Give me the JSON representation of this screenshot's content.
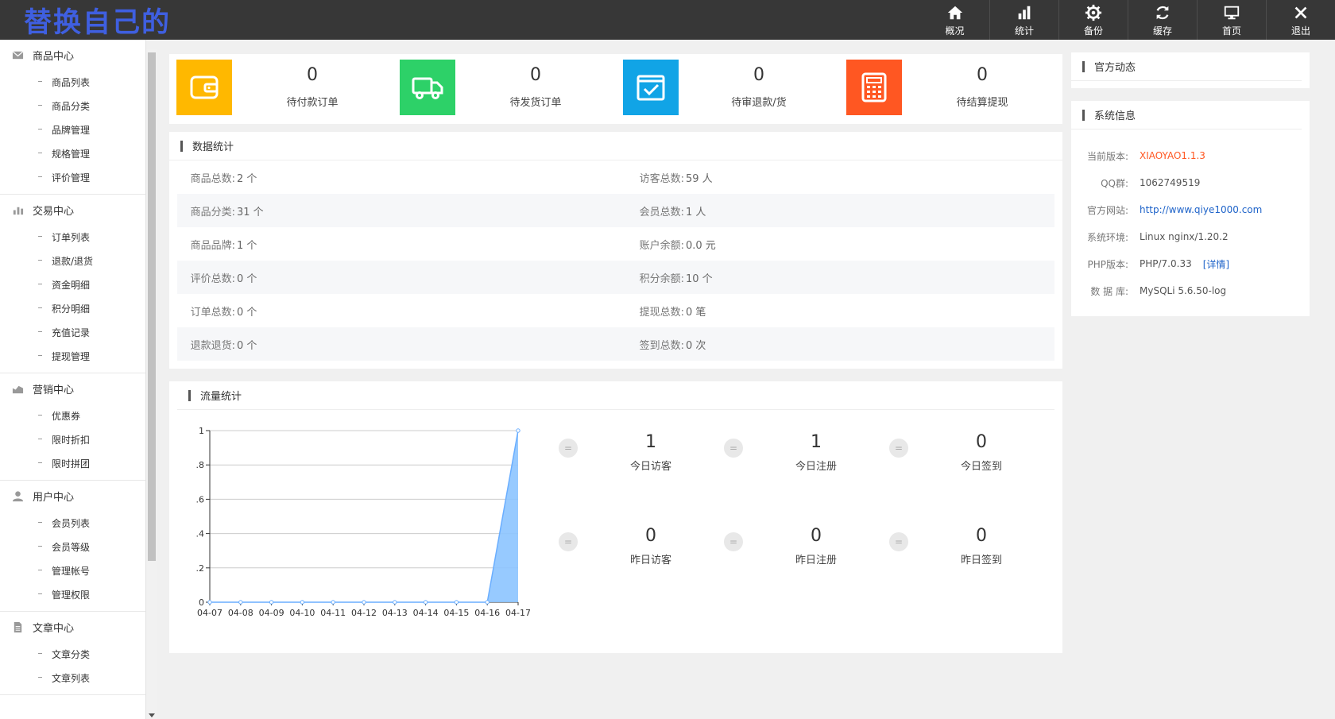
{
  "header": {
    "logo": "替换自己的",
    "nav": [
      {
        "label": "概况",
        "icon": "home-icon"
      },
      {
        "label": "统计",
        "icon": "bar-chart-icon"
      },
      {
        "label": "备份",
        "icon": "gear-icon"
      },
      {
        "label": "缓存",
        "icon": "refresh-icon"
      },
      {
        "label": "首页",
        "icon": "monitor-icon"
      },
      {
        "label": "退出",
        "icon": "close-icon"
      }
    ]
  },
  "sidebar": {
    "groups": [
      {
        "title": "商品中心",
        "icon": "goods-icon",
        "items": [
          "商品列表",
          "商品分类",
          "品牌管理",
          "规格管理",
          "评价管理"
        ]
      },
      {
        "title": "交易中心",
        "icon": "bar-chart-icon",
        "items": [
          "订单列表",
          "退款/退货",
          "资金明细",
          "积分明细",
          "充值记录",
          "提现管理"
        ]
      },
      {
        "title": "营销中心",
        "icon": "area-chart-icon",
        "items": [
          "优惠券",
          "限时折扣",
          "限时拼团"
        ]
      },
      {
        "title": "用户中心",
        "icon": "user-icon",
        "items": [
          "会员列表",
          "会员等级",
          "管理帐号",
          "管理权限"
        ]
      },
      {
        "title": "文章中心",
        "icon": "document-icon",
        "items": [
          "文章分类",
          "文章列表"
        ]
      }
    ]
  },
  "stats": [
    {
      "value": "0",
      "label": "待付款订单",
      "color": "#ffb800",
      "icon": "wallet-icon"
    },
    {
      "value": "0",
      "label": "待发货订单",
      "color": "#2dd168",
      "icon": "truck-icon"
    },
    {
      "value": "0",
      "label": "待审退款/货",
      "color": "#11a4e6",
      "icon": "checkbox-icon"
    },
    {
      "value": "0",
      "label": "待结算提现",
      "color": "#ff5722",
      "icon": "calculator-icon"
    }
  ],
  "data_stats": {
    "title": "数据统计",
    "rows": [
      [
        {
          "label": "商品总数:",
          "value": "2 个"
        },
        {
          "label": "访客总数:",
          "value": "59 人"
        }
      ],
      [
        {
          "label": "商品分类:",
          "value": "31 个"
        },
        {
          "label": "会员总数:",
          "value": "1 人"
        }
      ],
      [
        {
          "label": "商品品牌:",
          "value": "1 个"
        },
        {
          "label": "账户余额:",
          "value": "0.0 元"
        }
      ],
      [
        {
          "label": "评价总数:",
          "value": "0 个"
        },
        {
          "label": "积分余额:",
          "value": "10 个"
        }
      ],
      [
        {
          "label": "订单总数:",
          "value": "0 个"
        },
        {
          "label": "提现总数:",
          "value": "0 笔"
        }
      ],
      [
        {
          "label": "退款退货:",
          "value": "0 个"
        },
        {
          "label": "签到总数:",
          "value": "0 次"
        }
      ]
    ]
  },
  "traffic": {
    "title": "流量统计",
    "kpis": [
      {
        "value": "1",
        "label": "今日访客"
      },
      {
        "value": "1",
        "label": "今日注册"
      },
      {
        "value": "0",
        "label": "今日签到"
      },
      {
        "value": "0",
        "label": "昨日访客"
      },
      {
        "value": "0",
        "label": "昨日注册"
      },
      {
        "value": "0",
        "label": "昨日签到"
      }
    ],
    "eq_symbol": "="
  },
  "chart_data": {
    "type": "area",
    "x": [
      "04-07",
      "04-08",
      "04-09",
      "04-10",
      "04-11",
      "04-12",
      "04-13",
      "04-14",
      "04-15",
      "04-16",
      "04-17"
    ],
    "series": [
      {
        "values": [
          0,
          0,
          0,
          0,
          0,
          0,
          0,
          0,
          0,
          0,
          1
        ]
      }
    ],
    "ylim": [
      0,
      1
    ],
    "yticks": [
      "0",
      "0.2",
      "0.4",
      "0.6",
      "0.8",
      "1"
    ],
    "grid": true,
    "color": "#8cc4ff",
    "line_color": "#6aaeff"
  },
  "news": {
    "title": "官方动态"
  },
  "system": {
    "title": "系统信息",
    "rows": [
      {
        "label": "当前版本:",
        "value": "XIAOYAO1.1.3",
        "style": "orange"
      },
      {
        "label": "QQ群:",
        "value": "1062749519",
        "style": ""
      },
      {
        "label": "官方网站:",
        "value": "http://www.qiye1000.com",
        "style": "link"
      },
      {
        "label": "系统环境:",
        "value": "Linux nginx/1.20.2",
        "style": ""
      },
      {
        "label": "PHP版本:",
        "value": "PHP/7.0.33",
        "style": "",
        "extra": "[详情]"
      },
      {
        "label": "数 据 库:",
        "value": "MySQLi 5.6.50-log",
        "style": ""
      }
    ]
  }
}
